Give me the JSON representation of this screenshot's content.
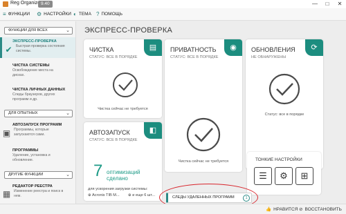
{
  "window": {
    "app_title": "Reg Organizer",
    "version": "9.40",
    "controls": {
      "minimize": "—",
      "maximize": "□",
      "close": "✕"
    }
  },
  "menu": {
    "items": [
      {
        "label": "ФУНКЦИИ",
        "icon": "list-icon"
      },
      {
        "label": "НАСТРОЙКИ",
        "icon": "gear-icon"
      },
      {
        "label": "ТЕМА",
        "icon": "palette-icon"
      },
      {
        "label": "ПОМОЩЬ",
        "icon": "help-icon"
      }
    ]
  },
  "sidebar": {
    "sections": [
      {
        "label": "ФУНКЦИИ ДЛЯ ВСЕХ"
      },
      {
        "label": "ДЛЯ ОПЫТНЫХ"
      },
      {
        "label": "ДРУГИЕ ФУНКЦИИ"
      }
    ],
    "items": [
      {
        "title": "ЭКСПРЕСС-ПРОВЕРКА",
        "desc": "Быстрая проверка состояния системы.",
        "icon": "shield-check-icon",
        "active": true
      },
      {
        "title": "ЧИСТКА СИСТЕМЫ",
        "desc": "Освобождение места на дисках.",
        "icon": "broom-icon"
      },
      {
        "title": "ЧИСТКА ЛИЧНЫХ ДАННЫХ",
        "desc": "Следы браузеров, других программ и др.",
        "icon": "privacy-icon"
      },
      {
        "title": "АВТОЗАПУСК ПРОГРАММ",
        "desc": "Программы, которые запускаются сами.",
        "icon": "autorun-icon"
      },
      {
        "title": "ПРОГРАММЫ",
        "desc": "Удаление, установка и обновление.",
        "icon": "programs-icon"
      },
      {
        "title": "РЕДАКТОР РЕЕСТРА",
        "desc": "Изменение реестра и поиск в нем.",
        "icon": "registry-icon"
      }
    ]
  },
  "main": {
    "title": "ЭКСПРЕСС-ПРОВЕРКА",
    "cards": {
      "cleaning": {
        "title": "ЧИСТКА",
        "status": "СТАТУС: ВСЕ В ПОРЯДКЕ",
        "note": "Чистка сейчас не требуется"
      },
      "privacy": {
        "title": "ПРИВАТНОСТЬ",
        "status": "СТАТУС: ВСЕ В ПОРЯДКЕ",
        "note": "Чистка сейчас не требуется"
      },
      "updates": {
        "title": "ОБНОВЛЕНИЯ",
        "status": "НЕ ОБНАРУЖЕНЫ",
        "note": "Статус: все в порядке"
      },
      "autorun": {
        "title": "АВТОЗАПУСК",
        "status": "СТАТУС: ВСЕ В ПОРЯДКЕ",
        "count": "7",
        "count_label": "оптимизаций сделано",
        "load_label": "для ускорения загрузки системы:",
        "app1": "Acronis TIB M...",
        "more": "и еще 6 шт..."
      },
      "settings": {
        "title": "ТОНКИЕ НАСТРОЙКИ"
      }
    },
    "traces": {
      "label": "СЛЕДЫ УДАЛЕННЫХ ПРОГРАММ",
      "count": "1"
    }
  },
  "statusbar": {
    "like": "НРАВИТСЯ",
    "restore": "ВОССТАНОВИТЬ"
  },
  "colors": {
    "accent": "#1c8d7f",
    "highlight": "#d8242b"
  }
}
